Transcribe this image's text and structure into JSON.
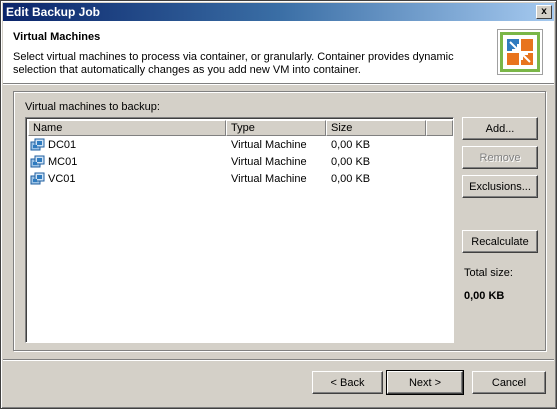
{
  "window": {
    "title": "Edit Backup Job",
    "close_glyph": "x"
  },
  "header": {
    "title": "Virtual Machines",
    "description": "Select virtual machines to process via container, or granularly. Container provides dynamic selection that automatically changes as you add new VM into container.",
    "logo_icon": "vm-selection-logo-icon"
  },
  "vm_list": {
    "label": "Virtual machines to backup:",
    "columns": [
      "Name",
      "Type",
      "Size"
    ],
    "rows": [
      {
        "name": "DC01",
        "type": "Virtual Machine",
        "size": "0,00 KB"
      },
      {
        "name": "MC01",
        "type": "Virtual Machine",
        "size": "0,00 KB"
      },
      {
        "name": "VC01",
        "type": "Virtual Machine",
        "size": "0,00 KB"
      }
    ]
  },
  "side_buttons": {
    "add": "Add...",
    "remove": "Remove",
    "exclusions": "Exclusions...",
    "recalculate": "Recalculate"
  },
  "total": {
    "label": "Total size:",
    "value": "0,00 KB"
  },
  "nav_buttons": {
    "back": "< Back",
    "next": "Next >",
    "cancel": "Cancel"
  },
  "colors": {
    "titlebar_start": "#0a246a",
    "titlebar_end": "#a6caf0",
    "dialog_face": "#d4d0c8",
    "logo_green": "#7ab648",
    "logo_orange": "#e8741e",
    "logo_blue": "#2f7bbf"
  }
}
